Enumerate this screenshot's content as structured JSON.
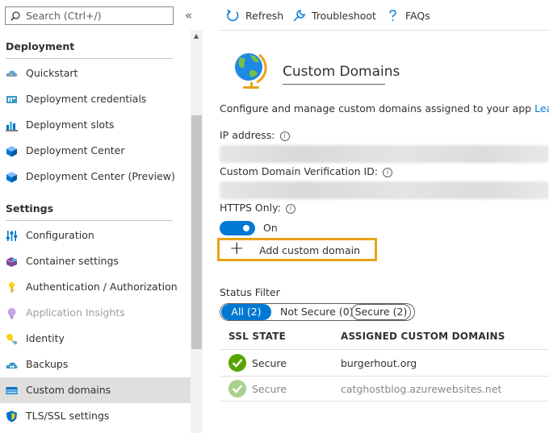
{
  "sidebar": {
    "search_placeholder": "Search (Ctrl+/)",
    "collapse_glyph": "«",
    "sections": [
      {
        "title": "Deployment",
        "items": [
          {
            "label": "Quickstart",
            "icon": "cloud-lightning-icon"
          },
          {
            "label": "Deployment credentials",
            "icon": "credentials-icon"
          },
          {
            "label": "Deployment slots",
            "icon": "slots-icon"
          },
          {
            "label": "Deployment Center",
            "icon": "cube-icon"
          },
          {
            "label": "Deployment Center (Preview)",
            "icon": "cube-icon"
          }
        ]
      },
      {
        "title": "Settings",
        "items": [
          {
            "label": "Configuration",
            "icon": "sliders-icon"
          },
          {
            "label": "Container settings",
            "icon": "container-icon"
          },
          {
            "label": "Authentication / Authorization",
            "icon": "key-icon"
          },
          {
            "label": "Application Insights",
            "icon": "lightbulb-icon",
            "disabled": true
          },
          {
            "label": "Identity",
            "icon": "identity-key-icon"
          },
          {
            "label": "Backups",
            "icon": "cloud-backup-icon"
          },
          {
            "label": "Custom domains",
            "icon": "domain-icon",
            "selected": true
          },
          {
            "label": "TLS/SSL settings",
            "icon": "shield-icon"
          }
        ]
      }
    ]
  },
  "toolbar": {
    "refresh_label": "Refresh",
    "troubleshoot_label": "Troubleshoot",
    "faqs_label": "FAQs"
  },
  "main": {
    "title": "Custom Domains",
    "description": "Configure and manage custom domains assigned to your app",
    "learn_more": "Lea",
    "ip_label": "IP address:",
    "verification_label": "Custom Domain Verification ID:",
    "https_label": "HTTPS Only:",
    "https_state": "On",
    "https_enabled": true,
    "add_domain_label": "Add custom domain",
    "status_filter_label": "Status Filter",
    "filters": [
      "All (2)",
      "Not Secure (0)",
      "Secure (2)"
    ],
    "active_filter": "All (2)",
    "table": {
      "columns": [
        "SSL STATE",
        "ASSIGNED CUSTOM DOMAINS"
      ],
      "rows": [
        {
          "ssl_state": "Secure",
          "domain": "burgerhout.org"
        },
        {
          "ssl_state": "Secure",
          "domain": "catghostblog.azurewebsites.net"
        }
      ]
    }
  },
  "colors": {
    "accent": "#0078d4",
    "highlight_border": "#e8a317",
    "success": "#57a300",
    "success_faded": "#a9d18e"
  }
}
